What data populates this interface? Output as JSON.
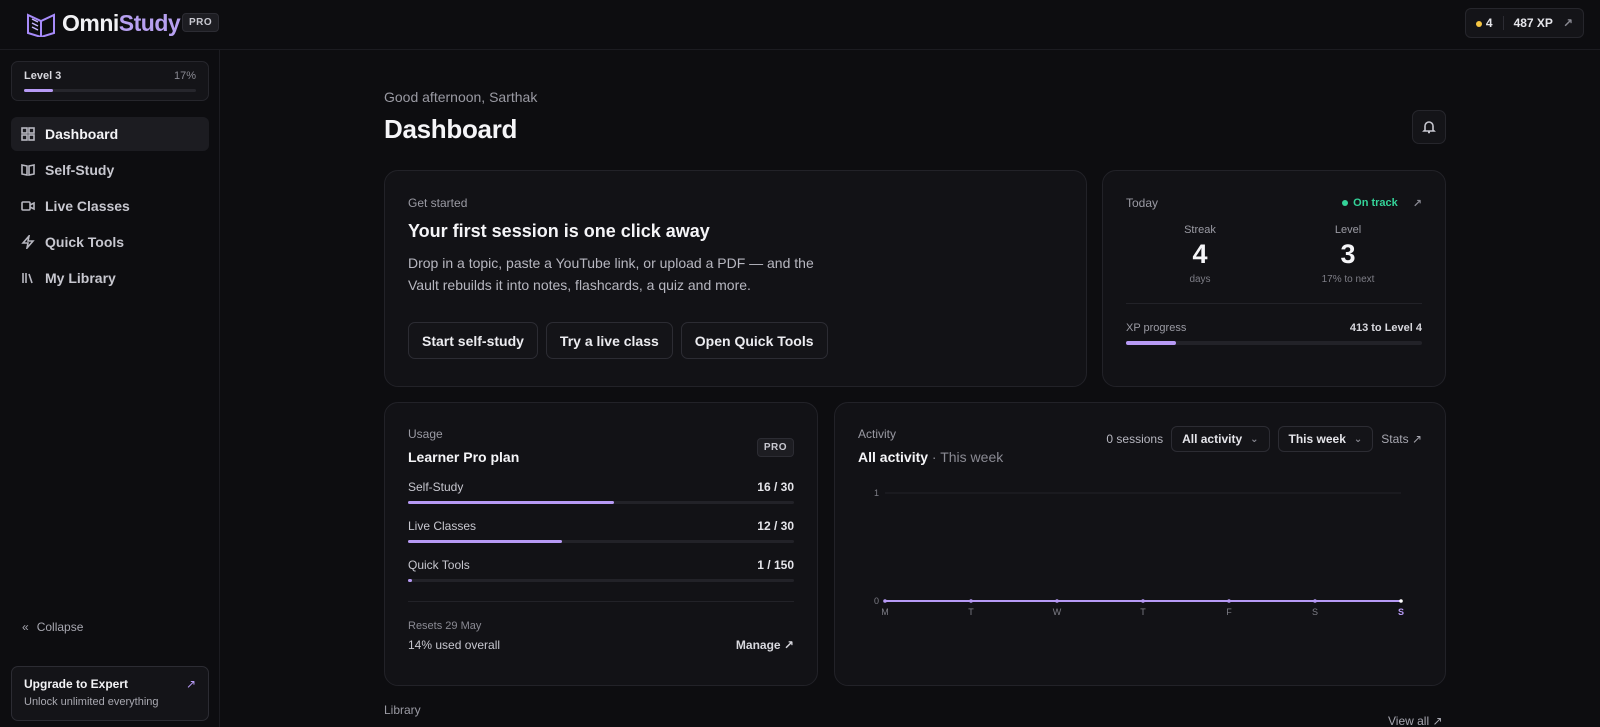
{
  "app": {
    "name_part1": "Omni",
    "name_part2": "Study",
    "tier": "PRO"
  },
  "header": {
    "coins": "4",
    "xp": "487 XP",
    "xp_arrow": "↗"
  },
  "sidebar": {
    "level_label": "Level 3",
    "level_pct": "17%",
    "level_progress": 0.17,
    "items": [
      {
        "label": "Dashboard",
        "icon": "grid-icon",
        "active": true
      },
      {
        "label": "Self-Study",
        "icon": "book-icon"
      },
      {
        "label": "Live Classes",
        "icon": "video-icon"
      },
      {
        "label": "Quick Tools",
        "icon": "bolt-icon"
      },
      {
        "label": "My Library",
        "icon": "library-icon"
      }
    ],
    "collapse_label": "Collapse",
    "upgrade": {
      "title": "Upgrade to Expert",
      "subtitle": "Unlock unlimited everything",
      "arrow": "↗"
    }
  },
  "main": {
    "greeting": "Good afternoon, Sarthak",
    "title": "Dashboard"
  },
  "get_started": {
    "eyebrow": "Get started",
    "heading": "Your first session is one click away",
    "body": "Drop in a topic, paste a YouTube link, or upload a PDF — and the Vault rebuilds it into notes, flashcards, a quiz and more.",
    "buttons": [
      "Start self-study",
      "Try a live class",
      "Open Quick Tools"
    ]
  },
  "today": {
    "eyebrow": "Today",
    "status": "On track",
    "arrow": "↗",
    "streak": {
      "label": "Streak",
      "value": "4",
      "sub": "days"
    },
    "level": {
      "label": "Level",
      "value": "3",
      "sub": "17% to next"
    },
    "xp_label": "XP progress",
    "xp_remaining": "413 to Level 4",
    "xp_progress": 0.17
  },
  "usage": {
    "eyebrow": "Usage",
    "plan": "Learner Pro plan",
    "badge": "PRO",
    "rows": [
      {
        "name": "Self-Study",
        "value": "16 / 30",
        "fraction": 0.533
      },
      {
        "name": "Live Classes",
        "value": "12 / 30",
        "fraction": 0.4
      },
      {
        "name": "Quick Tools",
        "value": "1 / 150",
        "fraction": 0.0067
      }
    ],
    "resets": "Resets 29 May",
    "overall": "14% used overall",
    "manage": "Manage ↗"
  },
  "activity": {
    "eyebrow": "Activity",
    "title_main": "All activity",
    "title_sub": " · This week",
    "sessions": "0 sessions",
    "filter": "All activity",
    "range": "This week",
    "stats_link": "Stats ↗",
    "chevron": "⌄"
  },
  "chart_data": {
    "type": "line",
    "categories": [
      "M",
      "T",
      "W",
      "T",
      "F",
      "S",
      "S"
    ],
    "series": [
      {
        "values": [
          0,
          0,
          0,
          0,
          0,
          0,
          0
        ]
      }
    ],
    "ylim": [
      0,
      1
    ],
    "yticks": [
      "1",
      "0"
    ],
    "grid": true,
    "highlight_index": 6,
    "color": "#b79af5"
  },
  "library": {
    "label": "Library",
    "view_all": "View all ↗"
  }
}
